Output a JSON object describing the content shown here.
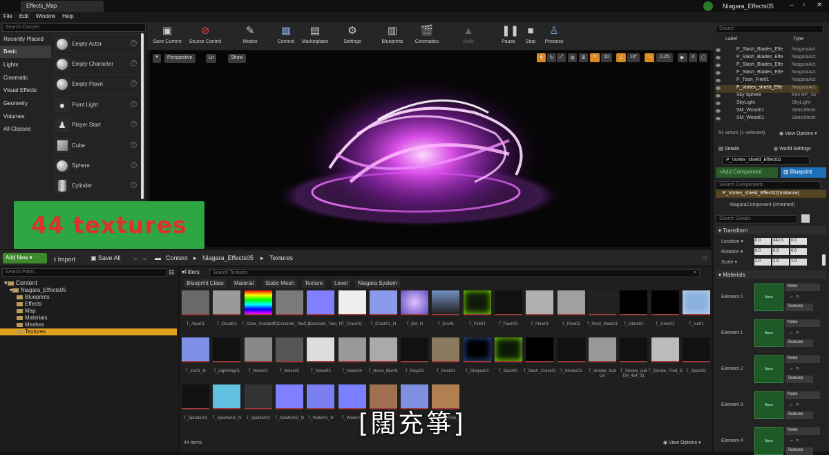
{
  "window": {
    "tab_title": "Effects_Map",
    "project_name": "Niagara_Effects05"
  },
  "menu": [
    "File",
    "Edit",
    "Window",
    "Help"
  ],
  "place_panel": {
    "search_placeholder": "Search Classes",
    "categories": [
      "Recently Placed",
      "Basic",
      "Lights",
      "Cinematic",
      "Visual Effects",
      "Geometry",
      "Volumes",
      "All Classes"
    ],
    "selected_category": "Basic",
    "items": [
      "Empty Actor",
      "Empty Character",
      "Empty Pawn",
      "Point Light",
      "Player Start",
      "Cube",
      "Sphere",
      "Cylinder"
    ]
  },
  "toolbar": [
    "Save Current",
    "Source Control",
    "Modes",
    "Content",
    "Marketplace",
    "Settings",
    "Blueprints",
    "Cinematics",
    "Build",
    "Pause",
    "Stop",
    "Possess"
  ],
  "viewport": {
    "perspective": "Perspective",
    "lit": "Lit",
    "show": "Show",
    "grid": "10",
    "angle": "10°",
    "scale": "0.25",
    "cam": "4"
  },
  "overlay_text": "44 textures",
  "content_browser": {
    "add_new": "Add New",
    "import": "Import",
    "save_all": "Save All",
    "path": [
      "Content",
      "Niagara_Effects05",
      "Textures"
    ],
    "search_paths": "Search Paths",
    "filters": "Filters",
    "search_textures": "Search Textures",
    "filter_chips": [
      "Blueprint Class",
      "Material",
      "Static Mesh",
      "Texture",
      "Level",
      "Niagara System"
    ],
    "tree": [
      "Content",
      "Niagara_Effects05",
      "Blueprints",
      "Effects",
      "Map",
      "Materials",
      "Meshes",
      "Textures"
    ],
    "assets": [
      "T_Aura01",
      "T_Cloud01",
      "T_Color_Gradient01",
      "T_Concrete_Tiles_D",
      "T_Concrete_Tiles_N",
      "T_Crack01",
      "T_Crack01_N",
      "T_Dot_N",
      "T_Env01",
      "T_Fire01",
      "T_Flash01",
      "T_Flow01",
      "T_Flow02",
      "T_Frost_Mask01",
      "T_Glare01",
      "T_Glow01",
      "T_Ice01",
      "T_Ice01_N",
      "T_Lightning01",
      "T_Noise01",
      "T_Noise02",
      "T_Noise03",
      "T_Noise04",
      "T_Noise_Blur01",
      "T_Rays01",
      "T_Rock01",
      "T_Shapes01",
      "T_Slash01",
      "T_Slash_Crack01",
      "T_Smoke01",
      "T_Smoke_Sub UV",
      "T_Smoke_sub UV_4x4_01",
      "T_Smoke_Tiled_D",
      "T_Spark01",
      "T_Splatter01",
      "T_Splatter01_N",
      "T_Splatter02",
      "T_Splatter02_N",
      "T_Water01_N",
      "T_Water02",
      "",
      "",
      "T_Wood_Pine_D"
    ],
    "item_count": "44 items",
    "view_options": "View Options"
  },
  "outliner": {
    "search": "Search",
    "col_label": "Label",
    "col_type": "Type",
    "rows": [
      {
        "label": "P_Slash_Blades_Effe",
        "type": "NiagaraAct"
      },
      {
        "label": "P_Slash_Blades_Effe",
        "type": "NiagaraAct"
      },
      {
        "label": "P_Slash_Blades_Effe",
        "type": "NiagaraAct"
      },
      {
        "label": "P_Slash_Blades_Effe",
        "type": "NiagaraAct"
      },
      {
        "label": "P_Toon_Fire01",
        "type": "NiagaraAct"
      },
      {
        "label": "P_Vortex_shield_Effe",
        "type": "NiagaraAct"
      },
      {
        "label": "Sky Sphere",
        "type": "Edit BP_Sk"
      },
      {
        "label": "SkyLight",
        "type": "SkyLight"
      },
      {
        "label": "SM_Wood01",
        "type": "StaticMesh"
      },
      {
        "label": "SM_Wood01",
        "type": "StaticMesh"
      }
    ],
    "selected_row": 5,
    "status": "61 actors (1 selected)",
    "view_options": "View Options"
  },
  "details": {
    "tab_details": "Details",
    "tab_world": "World Settings",
    "actor_name": "P_Vortex_shield_Effect02",
    "add_component": "+Add Component",
    "blueprint": "Blueprint",
    "search_components": "Search Components",
    "instance": "P_Vortex_shield_Effect02(Instance)",
    "component": "NiagaraComponent (Inherited)",
    "search_details": "Search Details",
    "transform": "Transform",
    "location": {
      "label": "Location",
      "x": "0.0",
      "y": "342.0",
      "z": "0.0"
    },
    "rotation": {
      "label": "Rotation",
      "x": "0.0",
      "y": "0.0",
      "z": "0.0"
    },
    "scale": {
      "label": "Scale",
      "x": "1.0",
      "y": "1.0",
      "z": "1.0"
    },
    "materials": "Materials",
    "elements": [
      "Element 0",
      "Element 1",
      "Element 2",
      "Element 3",
      "Element 4"
    ],
    "none": "None",
    "textures": "Textures"
  },
  "subtitle": "[闊充箏]"
}
